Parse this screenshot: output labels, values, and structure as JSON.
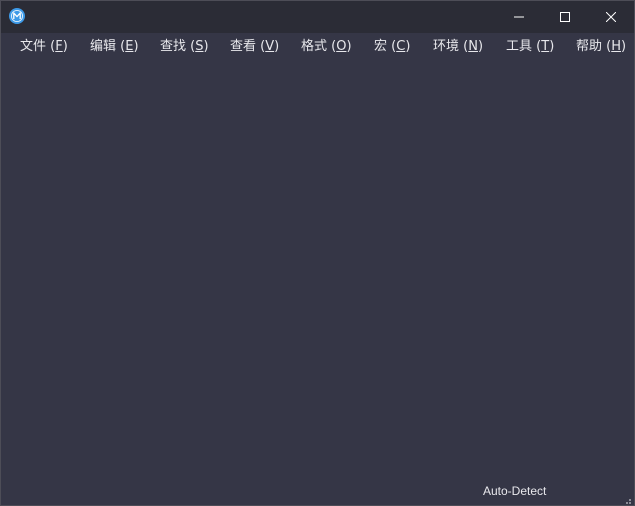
{
  "titlebar": {
    "app_icon": "m-logo-icon",
    "controls": {
      "minimize": "minimize-icon",
      "maximize": "maximize-icon",
      "close": "close-icon"
    }
  },
  "menubar": {
    "items": [
      {
        "label": "文件",
        "key": "F"
      },
      {
        "label": "编辑",
        "key": "E"
      },
      {
        "label": "查找",
        "key": "S"
      },
      {
        "label": "查看",
        "key": "V"
      },
      {
        "label": "格式",
        "key": "O"
      },
      {
        "label": "宏",
        "key": "C"
      },
      {
        "label": "环境",
        "key": "N"
      },
      {
        "label": "工具",
        "key": "T"
      },
      {
        "label": "帮助",
        "key": "H"
      }
    ]
  },
  "statusbar": {
    "encoding": "Auto-Detect",
    "grip": "resize-grip-icon"
  },
  "colors": {
    "background": "#353646",
    "titlebar": "#2b2c36",
    "text": "#e8e8ec",
    "app_icon": "#3d9ae8"
  }
}
